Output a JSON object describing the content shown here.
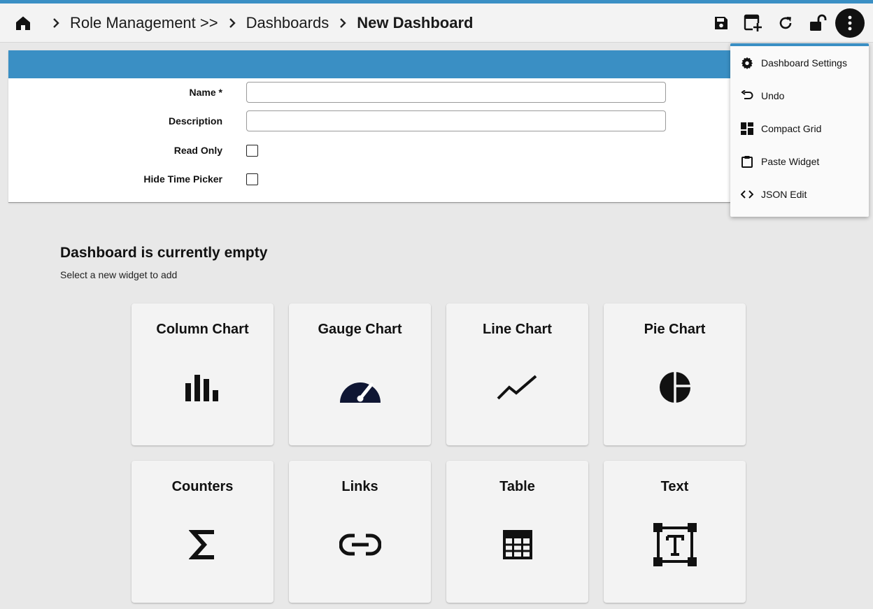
{
  "colors": {
    "accent": "#3a8fc4",
    "icon": "#111111",
    "page_bg": "#e8e8e8",
    "tile_bg": "#f3f3f3"
  },
  "breadcrumb": {
    "home_icon": "home-icon",
    "separator_icon": "chevron-right-icon",
    "items": [
      "Role Management >>",
      "Dashboards",
      "New Dashboard"
    ]
  },
  "toolbar": {
    "icons": [
      "save-icon",
      "add-widget-icon",
      "refresh-icon",
      "unlock-icon",
      "more-vertical-icon"
    ]
  },
  "form": {
    "name_label": "Name *",
    "name_value": "",
    "description_label": "Description",
    "description_value": "",
    "read_only_label": "Read Only",
    "read_only_checked": false,
    "hide_time_picker_label": "Hide Time Picker",
    "hide_time_picker_checked": false
  },
  "menu": {
    "items": [
      {
        "label": "Dashboard Settings",
        "icon": "gear-icon"
      },
      {
        "label": "Undo",
        "icon": "undo-icon"
      },
      {
        "label": "Compact Grid",
        "icon": "grid-icon"
      },
      {
        "label": "Paste Widget",
        "icon": "clipboard-icon"
      },
      {
        "label": "JSON Edit",
        "icon": "code-icon"
      }
    ]
  },
  "empty": {
    "title": "Dashboard is currently empty",
    "subtitle": "Select a new widget to add"
  },
  "widgets": [
    {
      "label": "Column Chart",
      "icon": "column-chart-icon"
    },
    {
      "label": "Gauge Chart",
      "icon": "gauge-icon"
    },
    {
      "label": "Line Chart",
      "icon": "line-chart-icon"
    },
    {
      "label": "Pie Chart",
      "icon": "pie-chart-icon"
    },
    {
      "label": "Counters",
      "icon": "sigma-icon"
    },
    {
      "label": "Links",
      "icon": "link-icon"
    },
    {
      "label": "Table",
      "icon": "table-icon"
    },
    {
      "label": "Text",
      "icon": "text-box-icon"
    }
  ]
}
